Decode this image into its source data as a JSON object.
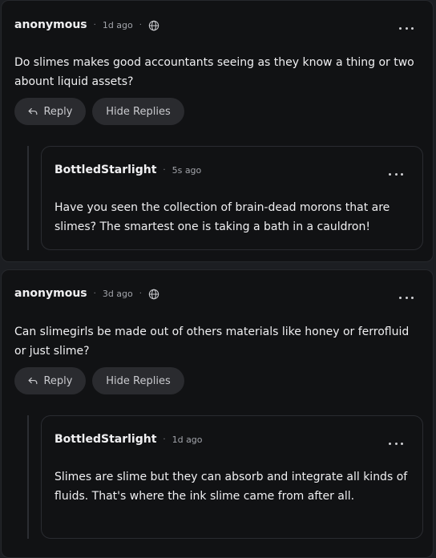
{
  "comments": [
    {
      "author": "anonymous",
      "time": "1d ago",
      "text": "Do slimes makes good accountants seeing as they know a thing or two abount liquid assets?",
      "reply_label": "Reply",
      "hide_label": "Hide Replies",
      "replies": [
        {
          "author": "BottledStarlight",
          "time": "5s ago",
          "text": "Have you seen the collection of brain-dead morons that are slimes? The smartest one is taking a bath in a cauldron!"
        }
      ]
    },
    {
      "author": "anonymous",
      "time": "3d ago",
      "text": "Can slimegirls be made out of others materials like honey or ferrofluid or just slime?",
      "reply_label": "Reply",
      "hide_label": "Hide Replies",
      "replies": [
        {
          "author": "BottledStarlight",
          "time": "1d ago",
          "text": "Slimes are slime but they can absorb and integrate all kinds of fluids. That's where the ink slime came from after all."
        }
      ]
    }
  ],
  "separator": "·",
  "icons": {
    "visibility": "globe-icon",
    "menu": "more-horizontal-icon",
    "reply": "reply-arrow-icon"
  },
  "colors": {
    "background": "#1c1e22",
    "card": "#111214",
    "button": "#2a2b2f",
    "text": "#f0f0f2",
    "muted": "#a2a4aa"
  }
}
